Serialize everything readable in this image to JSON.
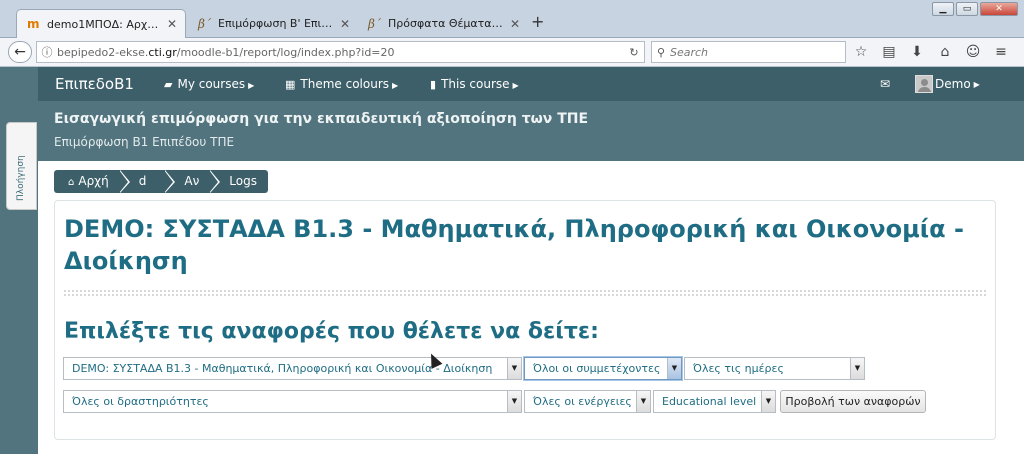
{
  "browser": {
    "tabs": [
      {
        "label": "demo1ΜΠΟΔ: Αρχεία κατ...",
        "favicon": "m",
        "active": true
      },
      {
        "label": "Επιμόρφωση Β' Επιπέδου ...",
        "favicon": "β΄",
        "active": false
      },
      {
        "label": "Πρόσφατα Θέματα - Συζη...",
        "favicon": "β΄",
        "active": false
      }
    ],
    "url_prefix": "bepipedo2-ekse.",
    "url_host": "cti.gr",
    "url_path": "/moodle-b1/report/log/index.php?id=20",
    "search_placeholder": "Search"
  },
  "topnav": {
    "brand": "ΕπιπεδοΒ1",
    "menus": [
      {
        "label": "My courses",
        "icon": "briefcase-icon"
      },
      {
        "label": "Theme colours",
        "icon": "grid-icon"
      },
      {
        "label": "This course",
        "icon": "book-icon"
      }
    ],
    "user": "Demo"
  },
  "header": {
    "course_title": "Εισαγωγική επιμόρφωση για την εκπαιδευτική αξιοποίηση των ΤΠΕ",
    "course_subtitle": "Επιμόρφωση Β1 Επιπέδου ΤΠΕ"
  },
  "block_tab": "Πλοήγηση",
  "breadcrumb": [
    "Αρχή",
    "d",
    "Αν",
    "Logs"
  ],
  "page": {
    "title": "DEMO: ΣΥΣΤΑΔΑ Β1.3 - Μαθηματικά, Πληροφορική και Οικονομία - Διοίκηση",
    "section_title": "Επιλέξτε τις αναφορές που θέλετε να δείτε:"
  },
  "filters": {
    "course": "DEMO: ΣΥΣΤΑΔΑ Β1.3 - Μαθηματικά, Πληροφορική και Οικονομία - Διοίκηση",
    "participants": "Όλοι οι συμμετέχοντες",
    "days": "Όλες τις ημέρες",
    "activities": "Όλες οι δραστηριότητες",
    "actions": "Όλες οι ενέργειες",
    "level": "Educational level",
    "submit": "Προβολή των αναφορών"
  }
}
